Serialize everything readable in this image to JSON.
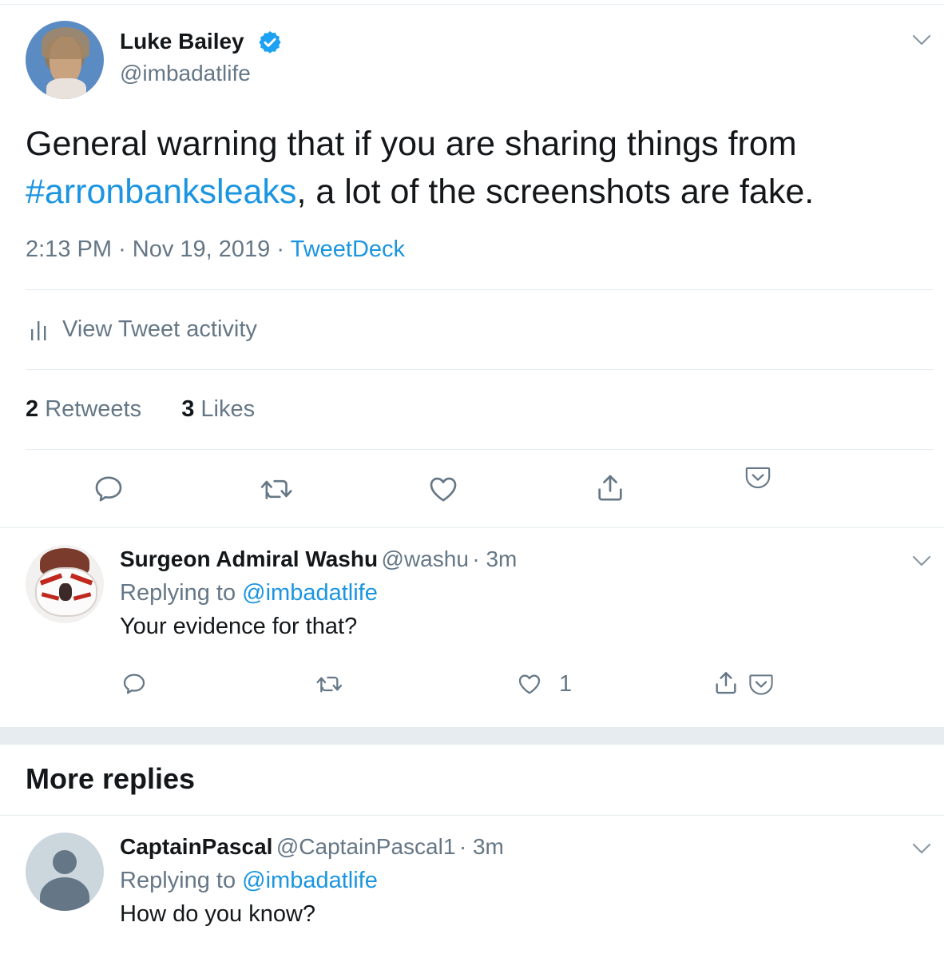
{
  "tweet": {
    "author_name": "Luke Bailey",
    "author_handle": "@imbadatlife",
    "text_line1": "General warning that if you are sharing things from",
    "hashtag": "#arronbanksleaks",
    "text_line2_rest": ", a lot of the screenshots are fake.",
    "time": "2:13 PM",
    "sep1": "·",
    "date": "Nov 19, 2019",
    "sep2": "·",
    "source": "TweetDeck",
    "activity_label": "View Tweet activity",
    "retweets_count": "2",
    "retweets_label": "Retweets",
    "likes_count": "3",
    "likes_label": "Likes"
  },
  "replies": [
    {
      "name": "Surgeon Admiral Washu",
      "handle": "@washu",
      "time": "· 3m",
      "replying_prefix": "Replying to",
      "replying_to": "@imbadatlife",
      "text": "Your evidence for that?",
      "like_count": "1"
    }
  ],
  "more_replies": {
    "heading": "More replies",
    "items": [
      {
        "name": "CaptainPascal",
        "handle": "@CaptainPascal1",
        "time": "· 3m",
        "replying_prefix": "Replying to",
        "replying_to": "@imbadatlife",
        "text": "How do you know?"
      }
    ]
  },
  "colors": {
    "link": "#1b95e0",
    "secondary": "#657786",
    "divider": "#e6ecf0",
    "verified": "#1da1f2"
  },
  "icons": [
    "chevron-down-icon",
    "verified-badge-icon",
    "bar-chart-icon",
    "reply-icon",
    "retweet-icon",
    "like-icon",
    "share-icon",
    "pocket-save-icon",
    "default-avatar-icon"
  ]
}
